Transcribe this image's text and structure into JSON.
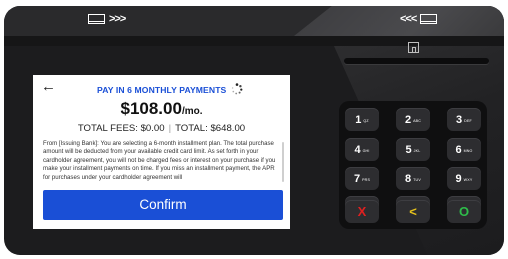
{
  "terminal": {
    "swipe_left_label": ">>>",
    "swipe_right_label": "<<<"
  },
  "screen": {
    "title": "PAY IN 6 MONTHLY PAYMENTS",
    "monthly_amount": "$108.00",
    "monthly_suffix": "/mo.",
    "total_fees": "TOTAL FEES: $0.00",
    "total_fees_sep": "|",
    "total": "TOTAL: $648.00",
    "disclosure": "From [Issuing Bank]: You are selecting a 6-month installment plan. The total purchase amount will be deducted from your available credit card limit. As set forth in your cardholder agreement, you will not be charged fees or interest on your purchase if you make your installment payments on time. If you miss an installment payment, the APR for purchases under your cardholder agreement will",
    "confirm_label": "Confirm"
  },
  "keypad": {
    "keys": [
      {
        "num": "1",
        "sub": "QZ"
      },
      {
        "num": "2",
        "sub": "ABC"
      },
      {
        "num": "3",
        "sub": "DEF"
      },
      {
        "num": "4",
        "sub": "GHI"
      },
      {
        "num": "5",
        "sub": "JKL"
      },
      {
        "num": "6",
        "sub": "MNO"
      },
      {
        "num": "7",
        "sub": "PRS"
      },
      {
        "num": "8",
        "sub": "TUV"
      },
      {
        "num": "9",
        "sub": "WXY"
      },
      {
        "num": "0",
        "sub": ""
      }
    ],
    "cancel": "X",
    "clear": "<",
    "enter": "O"
  },
  "colors": {
    "accent": "#1a4fd6",
    "cancel": "#e02020",
    "clear": "#e7c21b",
    "enter": "#2ebd4a"
  },
  "icons": [
    "back-arrow-icon",
    "spinner-icon",
    "card-slot-icon",
    "chip-insert-icon",
    "search-icon",
    "speaker-icon"
  ]
}
